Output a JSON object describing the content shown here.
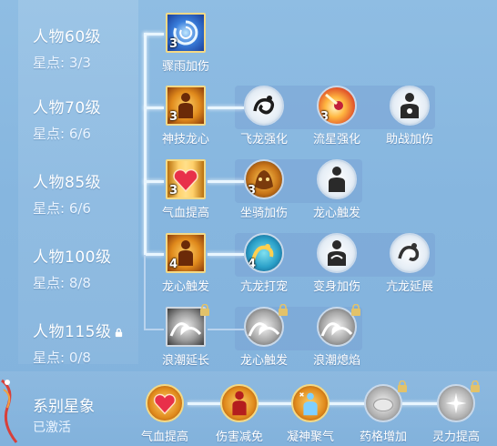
{
  "levels": [
    {
      "name": "人物60级",
      "stars": "星点: 3/3"
    },
    {
      "name": "人物70级",
      "stars": "星点: 6/6"
    },
    {
      "name": "人物85级",
      "stars": "星点: 6/6"
    },
    {
      "name": "人物100级",
      "stars": "星点: 8/8"
    },
    {
      "name": "人物115级",
      "stars": "星点: 0/8"
    }
  ],
  "rows": [
    {
      "main": {
        "label": "骤雨加伤",
        "badge": "3",
        "icon": "swirl-icon"
      },
      "subs": []
    },
    {
      "main": {
        "label": "神技龙心",
        "badge": "3",
        "icon": "figure-icon"
      },
      "subs": [
        {
          "label": "飞龙强化",
          "badge": "",
          "icon": "dragon-icon"
        },
        {
          "label": "流星强化",
          "badge": "3",
          "icon": "meteor-icon"
        },
        {
          "label": "助战加伤",
          "badge": "",
          "icon": "figure-icon"
        }
      ]
    },
    {
      "main": {
        "label": "气血提高",
        "badge": "3",
        "icon": "heart-icon"
      },
      "subs": [
        {
          "label": "坐骑加伤",
          "badge": "3",
          "icon": "beast-icon"
        },
        {
          "label": "龙心触发",
          "badge": "",
          "icon": "figure-icon"
        }
      ]
    },
    {
      "main": {
        "label": "龙心触发",
        "badge": "4",
        "icon": "figure-icon"
      },
      "subs": [
        {
          "label": "亢龙打宠",
          "badge": "4",
          "icon": "dragon-icon"
        },
        {
          "label": "变身加伤",
          "badge": "",
          "icon": "figure-icon"
        },
        {
          "label": "亢龙延展",
          "badge": "",
          "icon": "dragon-icon"
        }
      ]
    },
    {
      "main": {
        "label": "浪潮延长",
        "badge": "",
        "icon": "wave-icon",
        "locked": true
      },
      "subs": [
        {
          "label": "龙心触发",
          "badge": "",
          "icon": "wave-icon",
          "locked": true
        },
        {
          "label": "浪潮熄焰",
          "badge": "",
          "icon": "wave-icon",
          "locked": true
        }
      ]
    }
  ],
  "series": {
    "title": "系别星象",
    "status": "已激活",
    "nodes": [
      {
        "label": "气血提高",
        "icon": "heart-icon"
      },
      {
        "label": "伤害减免",
        "icon": "figure-icon"
      },
      {
        "label": "凝神聚气",
        "icon": "snowflake-figure-icon"
      },
      {
        "label": "药格增加",
        "icon": "pill-icon",
        "locked": true
      },
      {
        "label": "灵力提高",
        "icon": "sparkle-icon",
        "locked": true
      }
    ]
  },
  "colors": {
    "background": "#86b6df",
    "active_border": "#f4d985",
    "connector": "#e9f6ff"
  }
}
